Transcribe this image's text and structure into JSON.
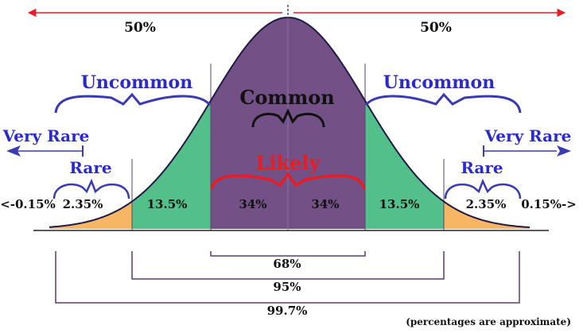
{
  "colors": {
    "center": "#735187",
    "inner": "#53c08b",
    "tail": "#f6b664",
    "curve": "#1f1b44",
    "blueText": "#2b2bcb",
    "blueBrace": "#3a3ab5",
    "red": "#e81c24",
    "dark": "#1a1a1a",
    "bracket": "#5a3b6e",
    "label": "#111111"
  },
  "top_halves": {
    "left": "50%",
    "right": "50%"
  },
  "regions": {
    "far_left": "<-0.15%",
    "left_tail": "2.35%",
    "left_inner": "13.5%",
    "center_left": "34%",
    "center_right": "34%",
    "right_inner": "13.5%",
    "right_tail": "2.35%",
    "far_right": "0.15%->"
  },
  "labels": {
    "common": "Common",
    "likely": "Likely",
    "uncommon_left": "Uncommon",
    "uncommon_right": "Uncommon",
    "rare_left": "Rare",
    "rare_right": "Rare",
    "very_rare_left": "Very Rare",
    "very_rare_right": "Very Rare"
  },
  "brackets": {
    "one_sigma": "68%",
    "two_sigma": "95%",
    "three_sigma": "99.7%"
  },
  "footnote": "(percentages are approximate)"
}
